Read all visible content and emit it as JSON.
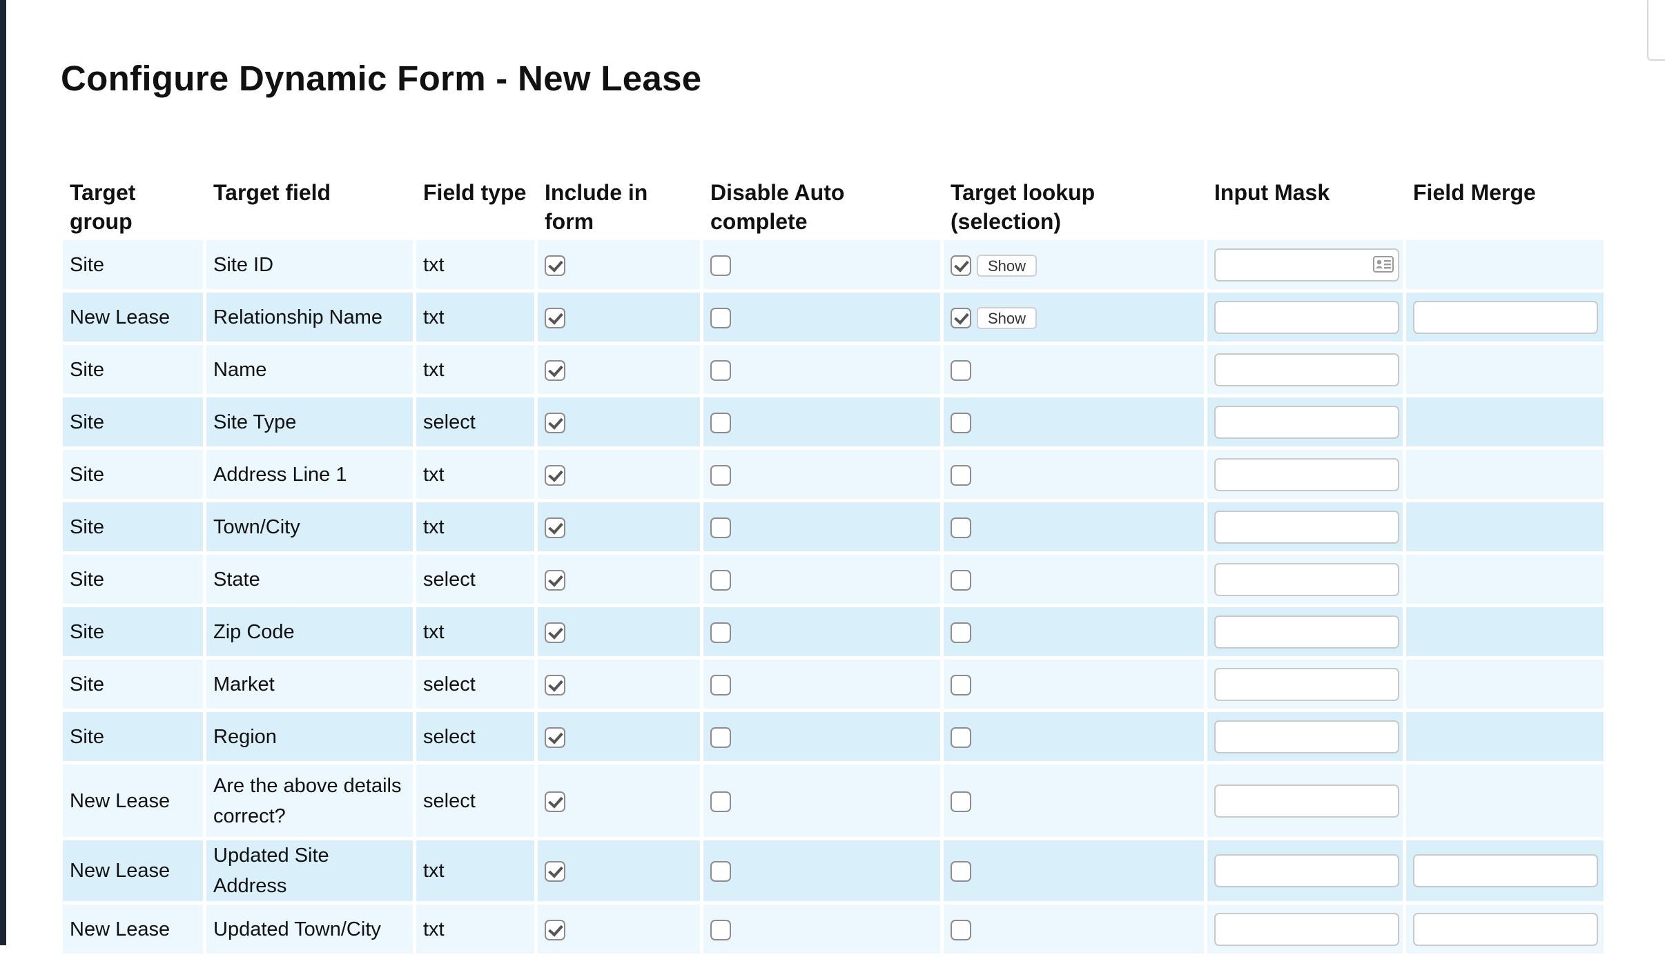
{
  "page": {
    "title": "Configure Dynamic Form - New Lease"
  },
  "table": {
    "headers": {
      "target_group": "Target group",
      "target_field": "Target field",
      "field_type": "Field type",
      "include_in_form": "Include in form",
      "disable_autocomplete": "Disable Auto complete",
      "target_lookup": "Target lookup (selection)",
      "input_mask": "Input Mask",
      "field_merge": "Field Merge"
    },
    "show_label": "Show",
    "rows": [
      {
        "group": "Site",
        "field": "Site ID",
        "type": "txt",
        "include": true,
        "disable_auto": false,
        "lookup": true,
        "show_button": true,
        "mask_value": "",
        "has_contact_icon": true,
        "has_merge": false,
        "merge_value": ""
      },
      {
        "group": "New Lease",
        "field": "Relationship Name",
        "type": "txt",
        "include": true,
        "disable_auto": false,
        "lookup": true,
        "show_button": true,
        "mask_value": "",
        "has_contact_icon": false,
        "has_merge": true,
        "merge_value": ""
      },
      {
        "group": "Site",
        "field": "Name",
        "type": "txt",
        "include": true,
        "disable_auto": false,
        "lookup": false,
        "show_button": false,
        "mask_value": "",
        "has_contact_icon": false,
        "has_merge": false,
        "merge_value": ""
      },
      {
        "group": "Site",
        "field": "Site Type",
        "type": "select",
        "include": true,
        "disable_auto": false,
        "lookup": false,
        "show_button": false,
        "mask_value": "",
        "has_contact_icon": false,
        "has_merge": false,
        "merge_value": ""
      },
      {
        "group": "Site",
        "field": "Address Line 1",
        "type": "txt",
        "include": true,
        "disable_auto": false,
        "lookup": false,
        "show_button": false,
        "mask_value": "",
        "has_contact_icon": false,
        "has_merge": false,
        "merge_value": ""
      },
      {
        "group": "Site",
        "field": "Town/City",
        "type": "txt",
        "include": true,
        "disable_auto": false,
        "lookup": false,
        "show_button": false,
        "mask_value": "",
        "has_contact_icon": false,
        "has_merge": false,
        "merge_value": ""
      },
      {
        "group": "Site",
        "field": "State",
        "type": "select",
        "include": true,
        "disable_auto": false,
        "lookup": false,
        "show_button": false,
        "mask_value": "",
        "has_contact_icon": false,
        "has_merge": false,
        "merge_value": ""
      },
      {
        "group": "Site",
        "field": "Zip Code",
        "type": "txt",
        "include": true,
        "disable_auto": false,
        "lookup": false,
        "show_button": false,
        "mask_value": "",
        "has_contact_icon": false,
        "has_merge": false,
        "merge_value": ""
      },
      {
        "group": "Site",
        "field": "Market",
        "type": "select",
        "include": true,
        "disable_auto": false,
        "lookup": false,
        "show_button": false,
        "mask_value": "",
        "has_contact_icon": false,
        "has_merge": false,
        "merge_value": ""
      },
      {
        "group": "Site",
        "field": "Region",
        "type": "select",
        "include": true,
        "disable_auto": false,
        "lookup": false,
        "show_button": false,
        "mask_value": "",
        "has_contact_icon": false,
        "has_merge": false,
        "merge_value": ""
      },
      {
        "group": "New Lease",
        "field": "Are the above details correct?",
        "type": "select",
        "include": true,
        "disable_auto": false,
        "lookup": false,
        "show_button": false,
        "mask_value": "",
        "has_contact_icon": false,
        "has_merge": false,
        "merge_value": ""
      },
      {
        "group": "New Lease",
        "field": "Updated Site Address",
        "type": "txt",
        "include": true,
        "disable_auto": false,
        "lookup": false,
        "show_button": false,
        "mask_value": "",
        "has_contact_icon": false,
        "has_merge": true,
        "merge_value": ""
      },
      {
        "group": "New Lease",
        "field": "Updated Town/City",
        "type": "txt",
        "include": true,
        "disable_auto": false,
        "lookup": false,
        "show_button": false,
        "mask_value": "",
        "has_contact_icon": false,
        "has_merge": true,
        "merge_value": ""
      }
    ]
  },
  "colors": {
    "row_light": "#ecf8fd",
    "row_dark": "#d9f0fa",
    "left_edge": "#1b2433"
  },
  "icons": {
    "mask_icon": "contact-card-icon"
  }
}
